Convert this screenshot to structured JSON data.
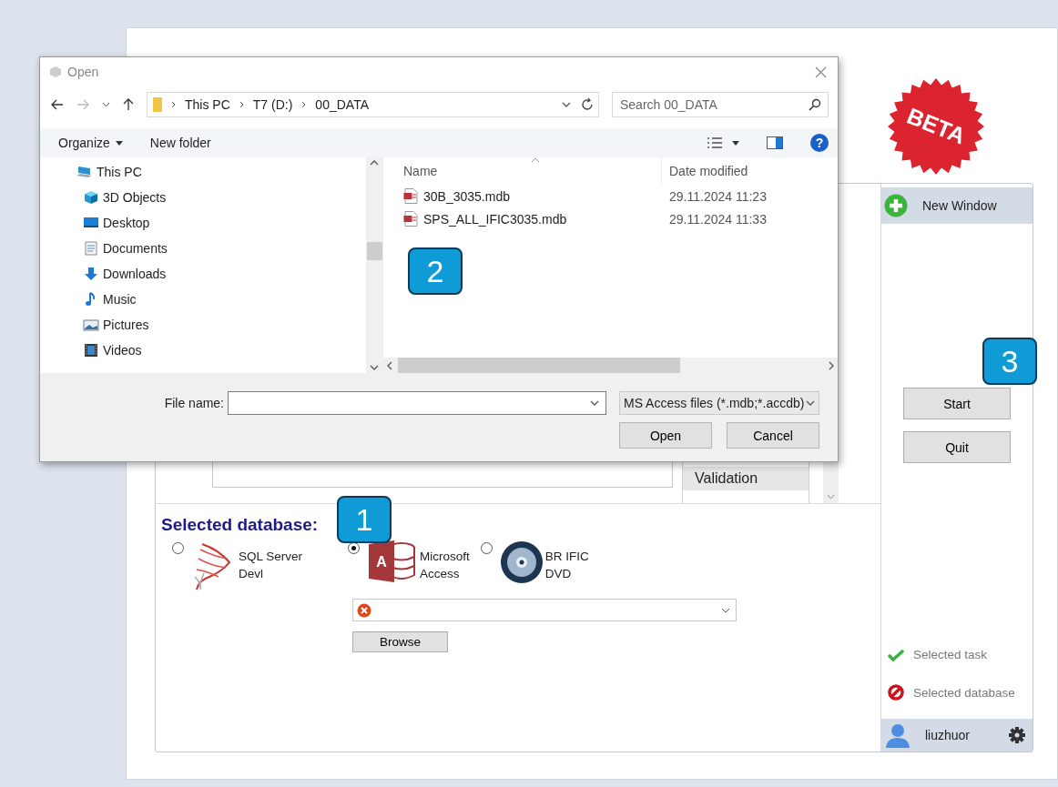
{
  "app": {
    "badge": "BETA",
    "main": {
      "validation_item": "Validation",
      "database": {
        "heading": "Selected database:",
        "options": [
          {
            "kind": "sqlserver",
            "lines": [
              "SQL Server",
              "Devl"
            ],
            "selected": false
          },
          {
            "kind": "access",
            "logo_letter": "A",
            "lines": [
              "Microsoft",
              "Access"
            ],
            "selected": true
          },
          {
            "kind": "dvd",
            "lines": [
              "BR IFIC",
              "DVD"
            ],
            "selected": false
          }
        ],
        "path_field": {
          "valid": false
        },
        "browse_button": "Browse"
      }
    },
    "sidebar": {
      "new_window": "New Window",
      "buttons": [
        "Start",
        "Quit"
      ],
      "status": [
        {
          "label": "Selected task",
          "ok": true
        },
        {
          "label": "Selected database",
          "ok": false
        }
      ],
      "user": "liuzhuor"
    }
  },
  "callouts": [
    {
      "number": "1"
    },
    {
      "number": "2"
    },
    {
      "number": "3"
    }
  ],
  "dialog": {
    "title": "Open",
    "breadcrumbs": [
      "This PC",
      "T7 (D:)",
      "00_DATA"
    ],
    "search": {
      "placeholder": "Search 00_DATA"
    },
    "toolbar": [
      "Organize",
      "New folder"
    ],
    "help_glyph": "?",
    "nav_items": [
      {
        "kind": "pc",
        "label": "This PC"
      },
      {
        "kind": "cube",
        "label": "3D Objects"
      },
      {
        "kind": "desktop",
        "label": "Desktop"
      },
      {
        "kind": "documents",
        "label": "Documents"
      },
      {
        "kind": "downloads",
        "label": "Downloads"
      },
      {
        "kind": "music",
        "label": "Music"
      },
      {
        "kind": "pictures",
        "label": "Pictures"
      },
      {
        "kind": "videos",
        "label": "Videos"
      }
    ],
    "columns": [
      "Name",
      "Date modified"
    ],
    "files": [
      {
        "name": "30B_3035.mdb",
        "date": "29.11.2024 11:23"
      },
      {
        "name": "SPS_ALL_IFIC3035.mdb",
        "date": "29.11.2024 11:33"
      }
    ],
    "file_name_label": "File name:",
    "filter": "MS Access files (*.mdb;*.accdb)",
    "buttons": [
      "Open",
      "Cancel"
    ]
  }
}
